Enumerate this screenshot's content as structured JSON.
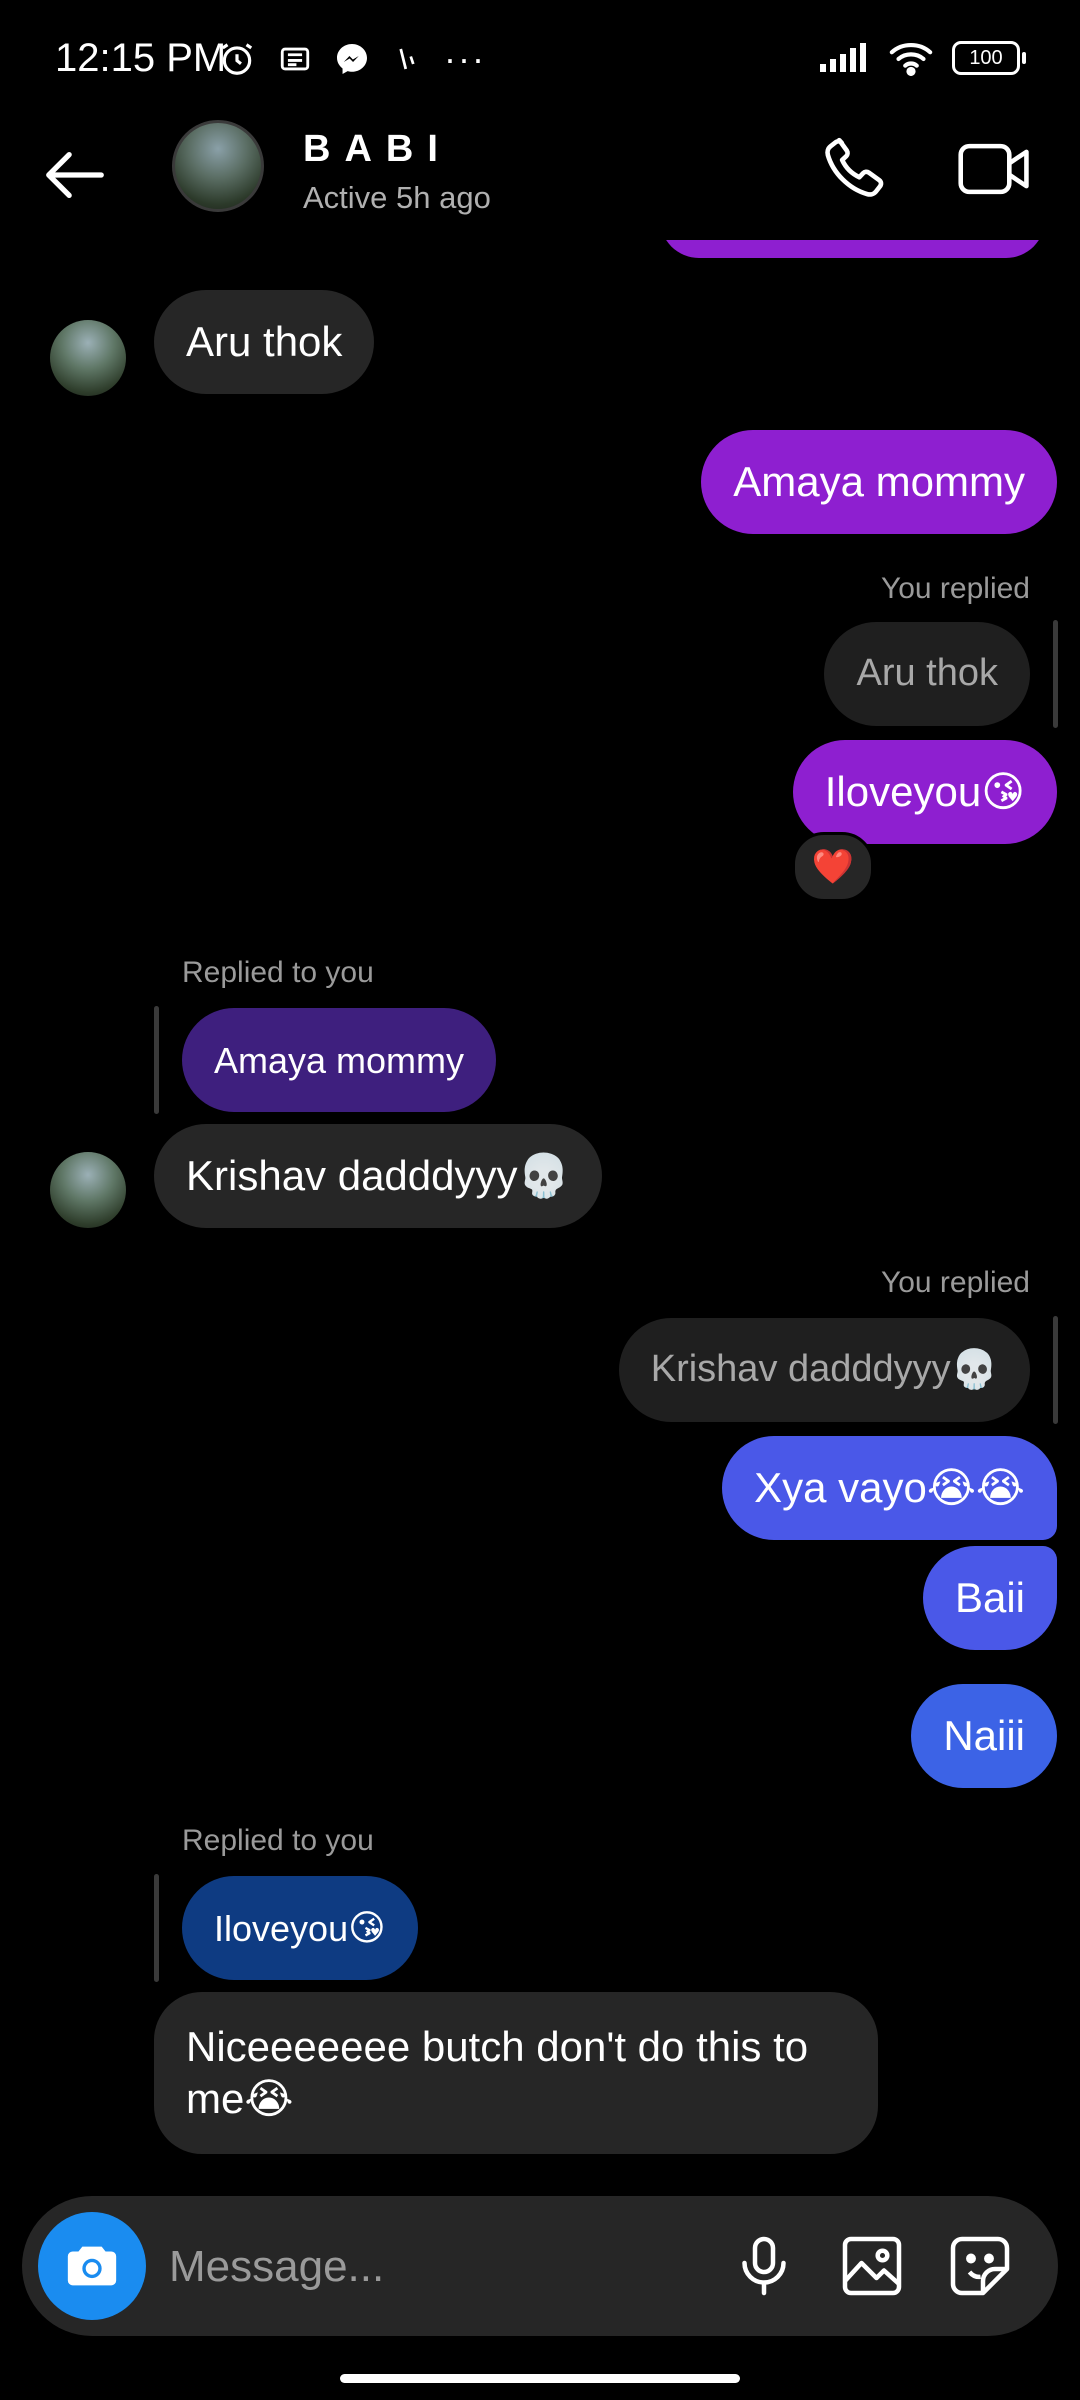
{
  "status_bar": {
    "time": "12:15 PM",
    "battery": "100",
    "more": "···"
  },
  "header": {
    "name": "BABI",
    "status": "Active 5h ago"
  },
  "messages": {
    "m1": "Aru thok",
    "m2": "Amaya mommy",
    "m3_meta": "You replied",
    "m3_quote": "Aru thok",
    "m3_text": "Iloveyou",
    "m3_emoji": "😘",
    "m3_reaction": "❤️",
    "m4_meta": "Replied to you",
    "m4_quote": "Amaya mommy",
    "m4_text": "Krishav dadddyyy",
    "m4_emoji": "💀",
    "m5_meta": "You replied",
    "m5_quote": "Krishav dadddyyy",
    "m5_quote_emoji": "💀",
    "m5_text": "Xya vayo",
    "m5_emoji": "😭😭",
    "m6": "Baii",
    "m7": "Naiii",
    "m8_meta": "Replied to you",
    "m8_quote": "Iloveyou",
    "m8_quote_emoji": "😘",
    "m8_line1": "Niceeeeeee butch don't do this to",
    "m8_line2": "me",
    "m8_emoji": "😭"
  },
  "composer": {
    "placeholder": "Message..."
  },
  "icons": {
    "back": "arrow-left-icon",
    "call": "phone-icon",
    "video": "video-camera-icon",
    "camera": "camera-icon",
    "mic": "microphone-icon",
    "gallery": "image-icon",
    "sticker": "sticker-icon"
  },
  "colors": {
    "outgoing_purple": "#8e1fd0",
    "outgoing_blue": "#4a58e8",
    "incoming": "#262626",
    "camera_button": "#1a8cf0"
  }
}
